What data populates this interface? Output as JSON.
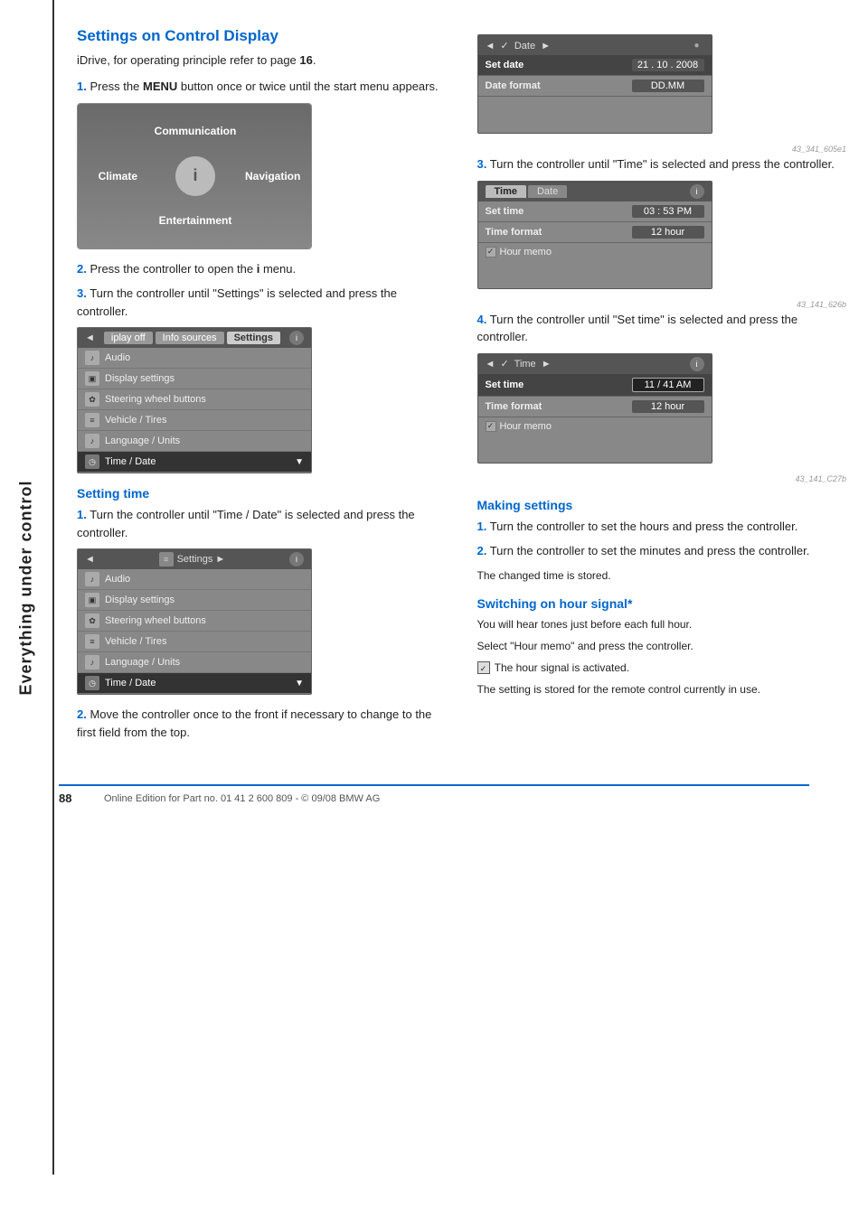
{
  "sidebar": {
    "label": "Everything under control"
  },
  "page": {
    "title": "Settings on Control Display",
    "intro": "iDrive, for operating principle refer to page 16.",
    "steps": [
      {
        "num": "1.",
        "text": "Press the MENU button once or twice until the start menu appears."
      },
      {
        "num": "2.",
        "text": "Press the controller to open the i menu."
      },
      {
        "num": "3.",
        "text": "Turn the controller until \"Settings\" is selected and press the controller."
      }
    ],
    "menu_items": {
      "communication": "Communication",
      "climate": "Climate",
      "navigation": "Navigation",
      "entertainment": "Entertainment"
    },
    "settings_screen": {
      "header_left": "◄",
      "header_tabs": [
        "iplay off",
        "Info sources",
        "Settings"
      ],
      "active_tab": "Settings",
      "icon_label": "i",
      "rows": [
        {
          "icon": "♪",
          "label": "Audio"
        },
        {
          "icon": "▣",
          "label": "Display settings"
        },
        {
          "icon": "✿",
          "label": "Steering wheel buttons"
        },
        {
          "icon": "≡",
          "label": "Vehicle / Tires"
        },
        {
          "icon": "♪",
          "label": "Language / Units"
        },
        {
          "icon": "◷",
          "label": "Time / Date"
        }
      ],
      "highlighted_row": 5
    },
    "setting_time_title": "Setting time",
    "setting_time_steps": [
      {
        "num": "1.",
        "text": "Turn the controller until \"Time / Date\" is selected and press the controller."
      },
      {
        "num": "2.",
        "text": "Move the controller once to the front if necessary to change to the first field from the top."
      }
    ]
  },
  "right_col": {
    "date_screen": {
      "header": "◄  ✓  Date  ►",
      "corner_icon": "●",
      "rows": [
        {
          "label": "Set date",
          "value": "21 . 10 . 2008",
          "selected": true
        },
        {
          "label": "Date format",
          "value": "DD.MM",
          "selected": false
        }
      ],
      "image_tag": "43_341_605e1"
    },
    "step3": {
      "num": "3.",
      "text": "Turn the controller until \"Time\" is selected and press the controller."
    },
    "time_date_screen": {
      "tabs": [
        "Time",
        "Date"
      ],
      "active_tab": "Time",
      "right_icon": "i",
      "rows": [
        {
          "label": "Set time",
          "value": "03 : 53 PM"
        },
        {
          "label": "Time format",
          "value": "12 hour"
        }
      ],
      "checkbox_row": "Hour memo",
      "image_tag": "43_141_626b"
    },
    "step4": {
      "num": "4.",
      "text": "Turn the controller until \"Set time\" is selected and press the controller."
    },
    "time_set_screen": {
      "header": "◄  ✓  Time  ►",
      "right_icon": "i",
      "rows": [
        {
          "label": "Set time",
          "value": "11 / 41 AM",
          "editing": true
        },
        {
          "label": "Time format",
          "value": "12 hour"
        }
      ],
      "checkbox_row": "Hour memo",
      "image_tag": "43_141_C27b"
    },
    "making_settings_title": "Making settings",
    "making_settings_steps": [
      {
        "num": "1.",
        "text": "Turn the controller to set the hours and press the controller."
      },
      {
        "num": "2.",
        "text": "Turn the controller to set the minutes and press the controller."
      }
    ],
    "stored_text": "The changed time is stored.",
    "switching_title": "Switching on hour signal*",
    "switching_para1": "You will hear tones just before each full hour.",
    "switching_para2": "Select \"Hour memo\" and press the controller.",
    "switching_check": "The hour signal is activated.",
    "switching_para3": "The setting is stored for the remote control currently in use."
  },
  "footer": {
    "page_number": "88",
    "copyright": "Online Edition for Part no. 01 41 2 600 809 - © 09/08 BMW AG"
  }
}
